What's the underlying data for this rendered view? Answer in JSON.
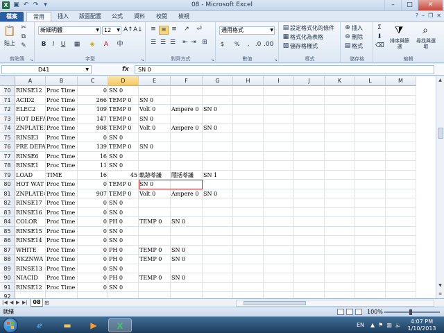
{
  "window": {
    "title": "08 - Microsoft Excel",
    "app_icon": "X",
    "qat": [
      "save-icon",
      "undo-icon",
      "redo-icon",
      "dropdown-icon"
    ]
  },
  "tabs": [
    "檔案",
    "常用",
    "插入",
    "版面配置",
    "公式",
    "資料",
    "校閱",
    "檢視"
  ],
  "active_tab": "常用",
  "ribbon": {
    "clipboard": {
      "label": "剪貼簿",
      "paste": "貼上"
    },
    "font": {
      "label": "字型",
      "name": "新細明體",
      "size": "12"
    },
    "alignment": {
      "label": "對齊方式"
    },
    "number": {
      "label": "數值",
      "format": "通用格式",
      "currency": "$",
      "percent": "%"
    },
    "styles": {
      "label": "樣式",
      "conditional": "設定格式化的條件",
      "table": "格式化為表格",
      "cell_styles": "儲存格樣式"
    },
    "cells": {
      "label": "儲存格",
      "insert": "插入",
      "delete": "刪除",
      "format": "格式"
    },
    "editing": {
      "label": "編輯",
      "sort": "排序與篩選",
      "find": "尋找與選取"
    }
  },
  "formula_bar": {
    "name_box": "D41",
    "fx": "fx",
    "content": "SN 0"
  },
  "columns": [
    "A",
    "B",
    "C",
    "D",
    "E",
    "F",
    "G",
    "H",
    "I",
    "J",
    "K",
    "L",
    "M"
  ],
  "selected_column": "D",
  "rows": [
    {
      "n": "70",
      "a": "RINSE12",
      "b": "Proc Time",
      "c": "0",
      "d": "SN 0",
      "e": "",
      "f": "",
      "g": ""
    },
    {
      "n": "71",
      "a": "ACID2",
      "b": "Proc Time",
      "c": "266",
      "d": "TEMP 0",
      "e": "SN 0",
      "f": "",
      "g": ""
    },
    {
      "n": "72",
      "a": "ELEC2",
      "b": "Proc Time",
      "c": "109",
      "d": "TEMP 0",
      "e": "Volt 0",
      "f": "Ampere 0",
      "g": "SN 0"
    },
    {
      "n": "73",
      "a": "HOT DEFA",
      "b": "Proc Time",
      "c": "147",
      "d": "TEMP 0",
      "e": "SN 0",
      "f": "",
      "g": ""
    },
    {
      "n": "74",
      "a": "ZNPLATE3",
      "b": "Proc Time",
      "c": "908",
      "d": "TEMP 0",
      "e": "Volt 0",
      "f": "Ampere 0",
      "g": "SN 0"
    },
    {
      "n": "75",
      "a": "RINSE3",
      "b": "Proc Time",
      "c": "0",
      "d": "SN 0",
      "e": "",
      "f": "",
      "g": ""
    },
    {
      "n": "76",
      "a": "PRE DEFA",
      "b": "Proc Time",
      "c": "139",
      "d": "TEMP 0",
      "e": "SN 0",
      "f": "",
      "g": ""
    },
    {
      "n": "77",
      "a": "RINSE6",
      "b": "Proc Time",
      "c": "16",
      "d": "SN 0",
      "e": "",
      "f": "",
      "g": ""
    },
    {
      "n": "78",
      "a": "RINSE1",
      "b": "Proc Time",
      "c": "11",
      "d": "SN 0",
      "e": "",
      "f": "",
      "g": ""
    },
    {
      "n": "79",
      "a": "LOAD",
      "b": "TIME",
      "c": "16",
      "d": "45",
      "e": "軌跡苓議",
      "f": "隱括苓議",
      "g": "SN 1"
    },
    {
      "n": "80",
      "a": "HOT WAT",
      "b": "Proc Time",
      "c": "0",
      "d": "TEMP 0",
      "e": "SN 0",
      "f": "",
      "g": ""
    },
    {
      "n": "81",
      "a": "ZNPLATE4",
      "b": "Proc Time",
      "c": "907",
      "d": "TEMP 0",
      "e": "Volt 0",
      "f": "Ampere 0",
      "g": "SN 0"
    },
    {
      "n": "82",
      "a": "RINSE17",
      "b": "Proc Time",
      "c": "0",
      "d": "SN 0",
      "e": "",
      "f": "",
      "g": ""
    },
    {
      "n": "83",
      "a": "RINSE16",
      "b": "Proc Time",
      "c": "0",
      "d": "SN 0",
      "e": "",
      "f": "",
      "g": ""
    },
    {
      "n": "84",
      "a": "COLOR",
      "b": "Proc Time",
      "c": "0",
      "d": "PH 0",
      "e": "TEMP 0",
      "f": "SN 0",
      "g": ""
    },
    {
      "n": "85",
      "a": "RINSE15",
      "b": "Proc Time",
      "c": "0",
      "d": "SN 0",
      "e": "",
      "f": "",
      "g": ""
    },
    {
      "n": "86",
      "a": "RINSE14",
      "b": "Proc Time",
      "c": "0",
      "d": "SN 0",
      "e": "",
      "f": "",
      "g": ""
    },
    {
      "n": "87",
      "a": "WHITE",
      "b": "Proc Time",
      "c": "0",
      "d": "PH 0",
      "e": "TEMP 0",
      "f": "SN 0",
      "g": ""
    },
    {
      "n": "88",
      "a": "NKZNWA",
      "b": "Proc Time",
      "c": "0",
      "d": "PH 0",
      "e": "TEMP 0",
      "f": "SN 0",
      "g": ""
    },
    {
      "n": "89",
      "a": "RINSE13",
      "b": "Proc Time",
      "c": "0",
      "d": "SN 0",
      "e": "",
      "f": "",
      "g": ""
    },
    {
      "n": "90",
      "a": "NIACID",
      "b": "Proc Time",
      "c": "0",
      "d": "PH 0",
      "e": "TEMP 0",
      "f": "SN 0",
      "g": ""
    },
    {
      "n": "91",
      "a": "RINSE12",
      "b": "Proc Time",
      "c": "0",
      "d": "SN 0",
      "e": "",
      "f": "",
      "g": ""
    },
    {
      "n": "92",
      "a": "",
      "b": "",
      "c": "",
      "d": "",
      "e": "",
      "f": "",
      "g": ""
    }
  ],
  "sheet_tab": "08",
  "status": {
    "ready": "就緒",
    "zoom": "100%"
  },
  "taskbar": {
    "lang": "EN",
    "time": "4:07 PM",
    "date": "1/10/2013"
  },
  "colors": {
    "file_tab": "#2a5fa4",
    "highlight_box": "#d21f1f",
    "selected_col": "#f6c861"
  }
}
